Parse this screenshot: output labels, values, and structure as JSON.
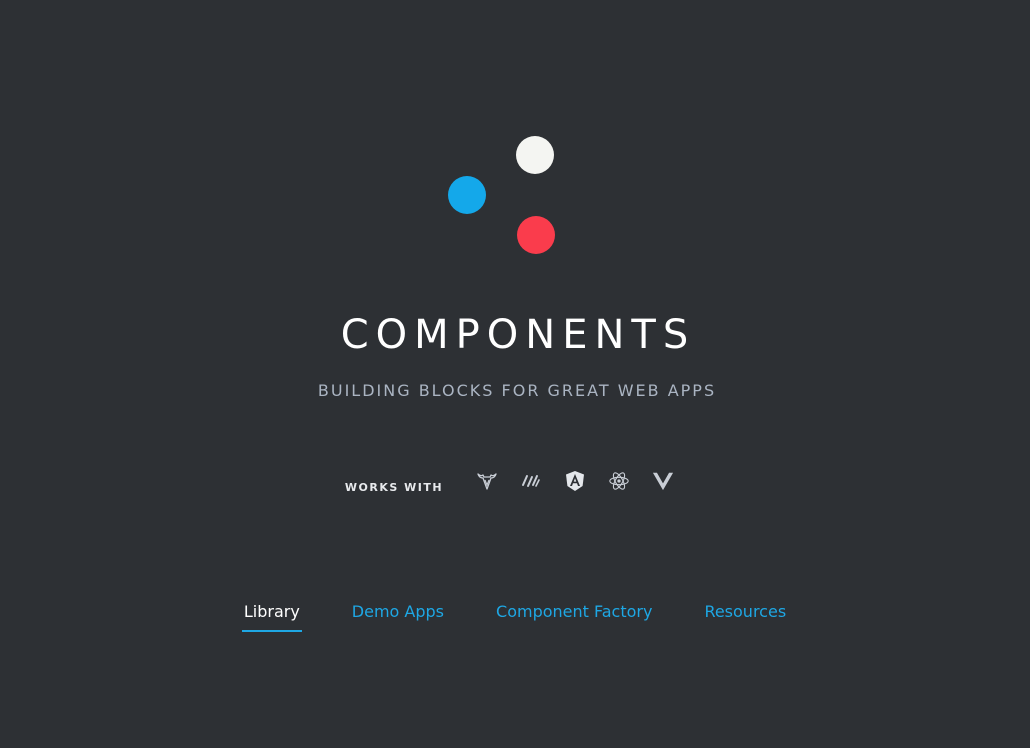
{
  "brand": {
    "title": "COMPONENTS",
    "subtitle": "BUILDING BLOCKS FOR GREAT WEB APPS",
    "dot_colors": {
      "white": "#f4f5f2",
      "blue": "#14a8ea",
      "red": "#fa3c4c"
    }
  },
  "works_with": {
    "label": "WORKS WITH",
    "frameworks": [
      {
        "icon": "jquery-bull-icon"
      },
      {
        "icon": "jquery-icon"
      },
      {
        "icon": "angular-icon"
      },
      {
        "icon": "react-icon"
      },
      {
        "icon": "vue-icon"
      }
    ]
  },
  "nav": {
    "items": [
      {
        "label": "Library",
        "active": true
      },
      {
        "label": "Demo Apps",
        "active": false
      },
      {
        "label": "Component Factory",
        "active": false
      },
      {
        "label": "Resources",
        "active": false
      }
    ],
    "active_color": "#ffffff",
    "link_color": "#1ea7e4"
  }
}
